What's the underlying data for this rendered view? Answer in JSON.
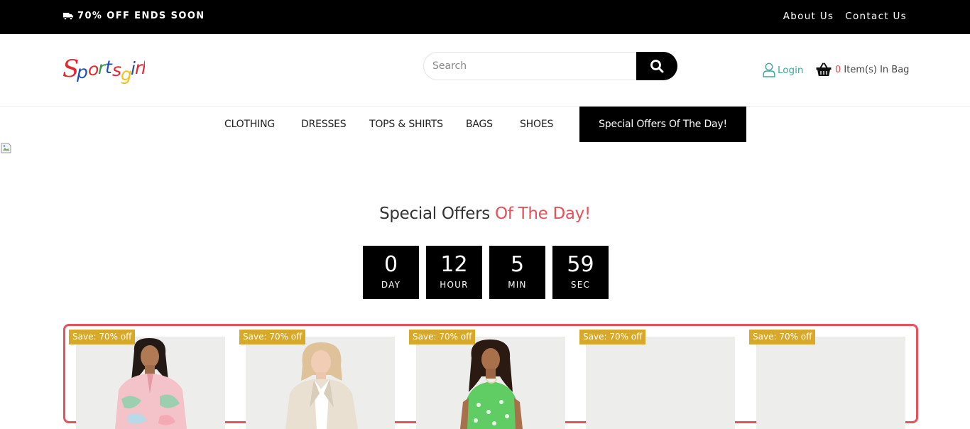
{
  "topbar": {
    "promo": "70% OFF ENDS SOON",
    "links": [
      "About Us",
      "Contact Us"
    ]
  },
  "header": {
    "logo_text": "Sportsgirl",
    "search_placeholder": "Search",
    "login": "Login",
    "bag_count": "0",
    "bag_label": "Item(s) In Bag"
  },
  "nav": {
    "items": [
      "CLOTHING",
      "DRESSES",
      "TOPS & SHIRTS",
      "BAGS",
      "SHOES"
    ],
    "special": "Special Offers Of The Day!"
  },
  "offers": {
    "title_plain": "Special Offers",
    "title_accent": "Of The Day!",
    "countdown": [
      {
        "value": "0",
        "label": "DAY"
      },
      {
        "value": "12",
        "label": "HOUR"
      },
      {
        "value": "5",
        "label": "MIN"
      },
      {
        "value": "59",
        "label": "SEC"
      }
    ],
    "badge": "Save: 70% off"
  },
  "colors": {
    "accent": "#e8505b",
    "badge": "#d8a82a",
    "login": "#3fa79b"
  }
}
